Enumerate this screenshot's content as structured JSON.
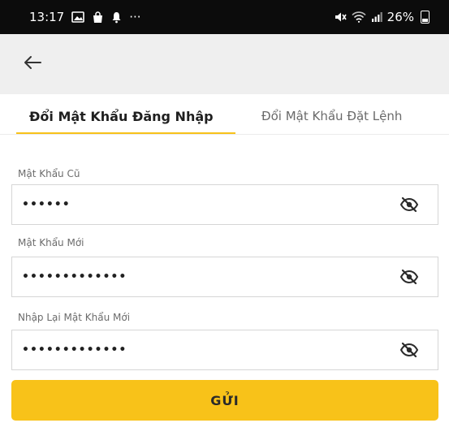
{
  "status_bar": {
    "time": "13:17",
    "left_icons": [
      "image-icon",
      "bag-icon",
      "bell-icon",
      "more-icon"
    ],
    "more_glyph": "···",
    "right_icons": [
      "mute-icon",
      "wifi-icon",
      "signal-icon",
      "battery-icon"
    ],
    "battery_text": "26%"
  },
  "app_bar": {
    "back_icon": "arrow-left-icon",
    "background": "#efefef"
  },
  "tabs": {
    "items": [
      {
        "label": "Đổi Mật Khẩu Đăng Nhập",
        "active": true
      },
      {
        "label": "Đổi Mật Khẩu Đặt Lệnh",
        "active": false
      }
    ],
    "accent_color": "#f7c21a"
  },
  "form": {
    "fields": [
      {
        "label": "Mật Khẩu Cũ",
        "value": "••••••",
        "icon": "eye-off-icon"
      },
      {
        "label": "Mật Khẩu Mới",
        "value": "•••••••••••••",
        "icon": "eye-off-icon"
      },
      {
        "label": "Nhập Lại Mật Khẩu Mới",
        "value": "•••••••••••••",
        "icon": "eye-off-icon"
      }
    ],
    "submit_label": "GỬI",
    "submit_color": "#f8c219"
  }
}
